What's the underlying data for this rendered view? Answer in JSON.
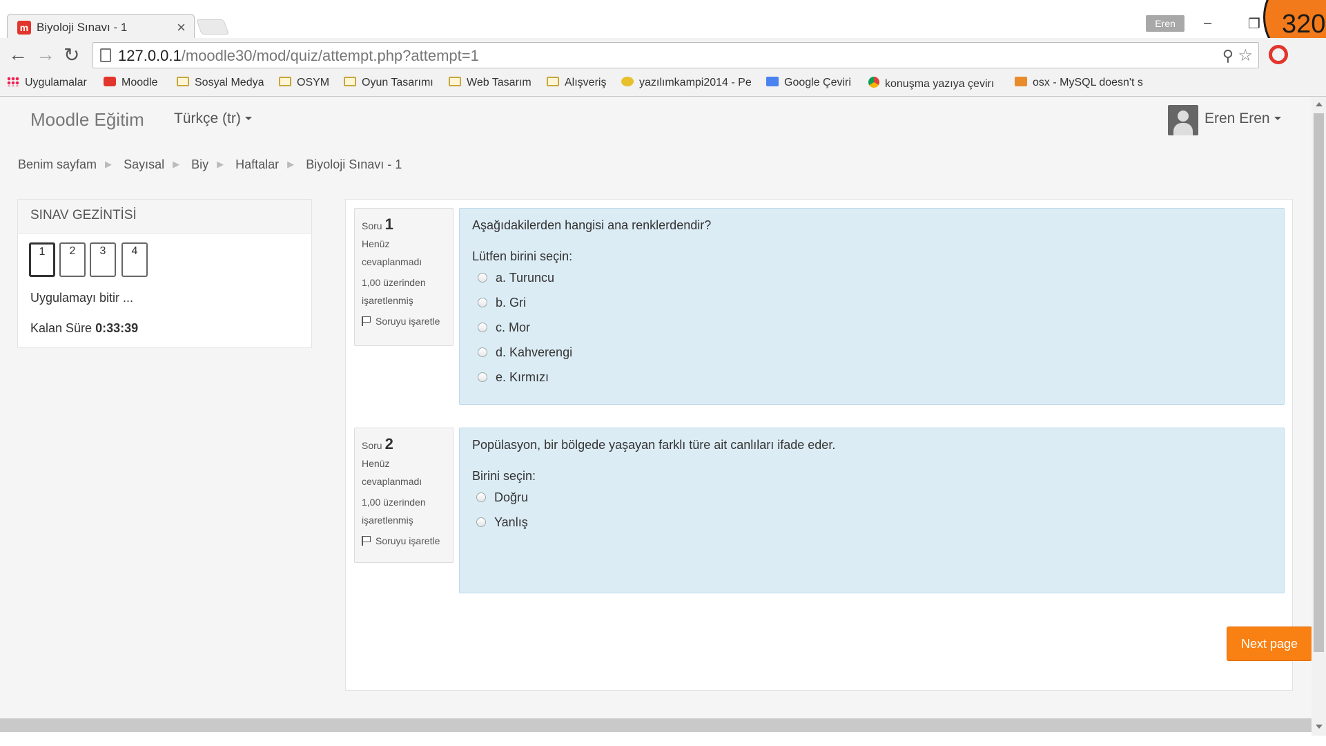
{
  "browser": {
    "tab_title": "Biyoloji Sınavı - 1",
    "profile_name": "Eren",
    "corner_badge": "320",
    "url_host": "127.0.0.1",
    "url_path": "/moodle30/mod/quiz/attempt.php?attempt=1"
  },
  "bookmarks": [
    {
      "label": "Uygulamalar",
      "icon": "apps-icon"
    },
    {
      "label": "Moodle",
      "icon": "moodle-icon"
    },
    {
      "label": "Sosyal Medya",
      "icon": "folder-icon"
    },
    {
      "label": "OSYM",
      "icon": "folder-icon"
    },
    {
      "label": "Oyun Tasarımı",
      "icon": "folder-icon"
    },
    {
      "label": "Web Tasarım",
      "icon": "folder-icon"
    },
    {
      "label": "Alışveriş",
      "icon": "folder-icon"
    },
    {
      "label": "yazılımkampi2014 - Pe",
      "icon": "fox-icon"
    },
    {
      "label": "Google Çeviri",
      "icon": "google-translate-icon"
    },
    {
      "label": "konuşma yazıya çevirı",
      "icon": "chrome-icon"
    },
    {
      "label": "osx - MySQL doesn't s",
      "icon": "java-icon"
    }
  ],
  "header": {
    "brand": "Moodle Eğitim",
    "language": "Türkçe (tr)",
    "user_name": "Eren Eren"
  },
  "breadcrumb": [
    "Benim sayfam",
    "Sayısal",
    "Biy",
    "Haftalar",
    "Biyoloji Sınavı - 1"
  ],
  "quiz_nav": {
    "title": "SINAV GEZİNTİSİ",
    "buttons": [
      "1",
      "2",
      "3",
      "4"
    ],
    "finish_label": "Uygulamayı bitir ...",
    "time_label": "Kalan Süre",
    "time_value": "0:33:39"
  },
  "questions": [
    {
      "label": "Soru",
      "number": "1",
      "status_line1": "Henüz",
      "status_line2": "cevaplanmadı",
      "grade_line1": "1,00 üzerinden",
      "grade_line2": "işaretlenmiş",
      "flag": "Soruyu işaretle",
      "text": "Aşağıdakilerden hangisi ana renklerdendir?",
      "prompt": "Lütfen birini seçin:",
      "options": [
        "a. Turuncu",
        "b. Gri",
        "c. Mor",
        "d. Kahverengi",
        "e. Kırmızı"
      ]
    },
    {
      "label": "Soru",
      "number": "2",
      "status_line1": "Henüz",
      "status_line2": "cevaplanmadı",
      "grade_line1": "1,00 üzerinden",
      "grade_line2": "işaretlenmiş",
      "flag": "Soruyu işaretle",
      "text": "Popülasyon, bir bölgede yaşayan farklı türe ait canlıları ifade eder.",
      "prompt": "Birini seçin:",
      "options": [
        "Doğru",
        "Yanlış"
      ]
    }
  ],
  "next_button": "Next page",
  "colors": {
    "accent": "#f98012",
    "question_bg": "#dcecf5",
    "page_bg": "#f5f5f5"
  }
}
